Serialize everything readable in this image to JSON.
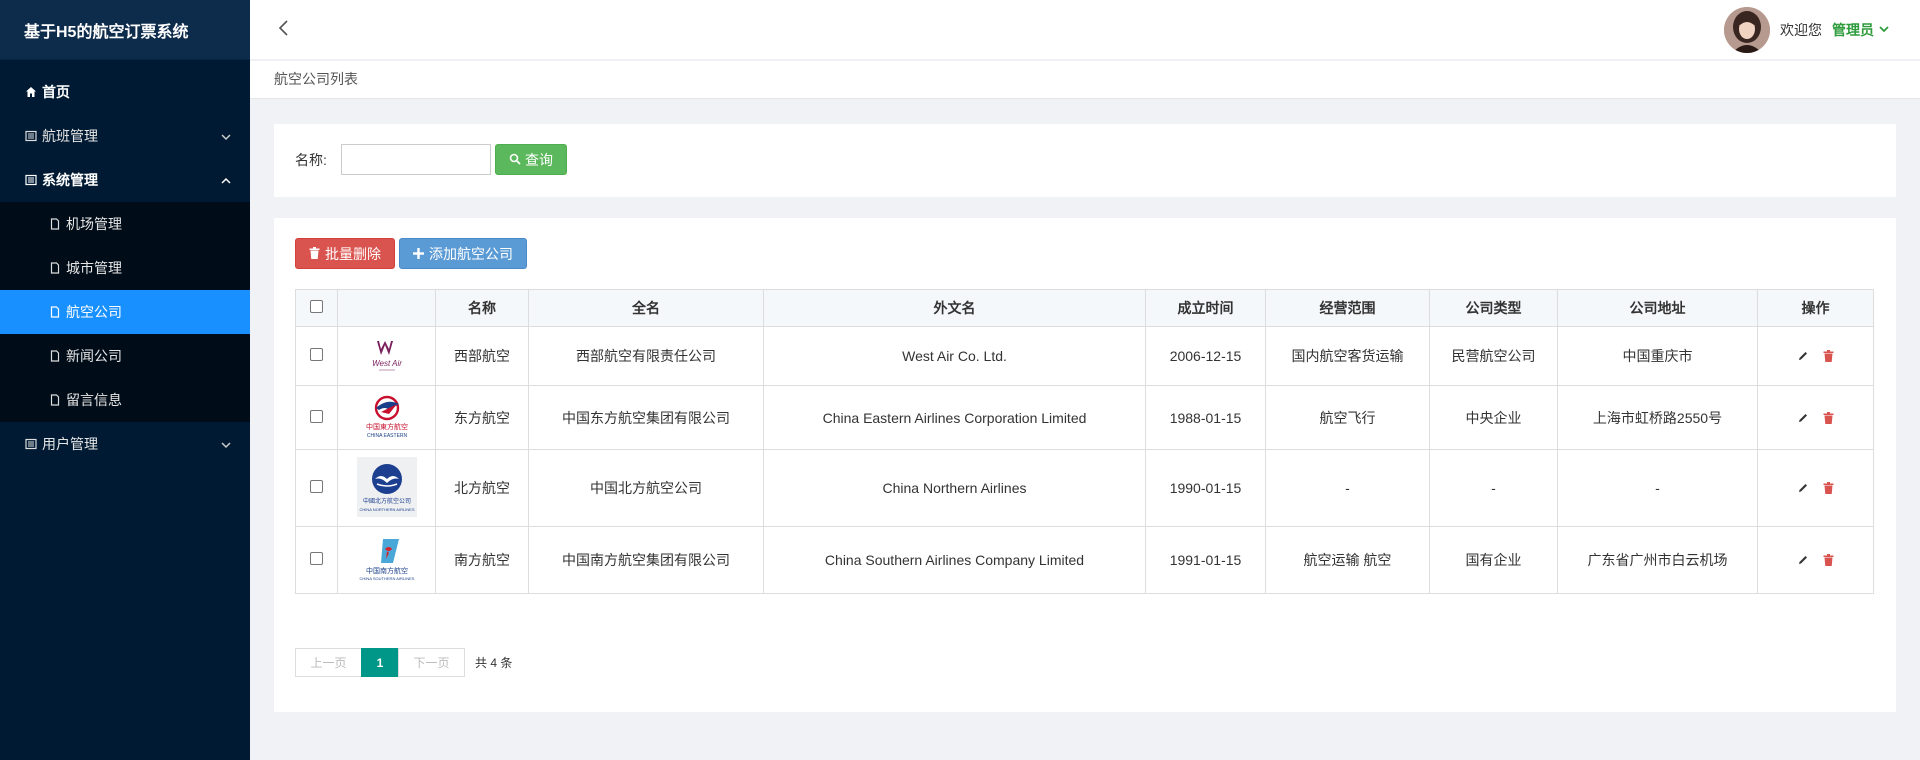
{
  "app": {
    "title": "基于H5的航空订票系统"
  },
  "sidebar": {
    "items": [
      {
        "label": "首页",
        "icon": "home-icon"
      },
      {
        "label": "航班管理",
        "icon": "list-icon",
        "arrow": "chevron-down-icon"
      },
      {
        "label": "系统管理",
        "icon": "list-icon",
        "arrow": "chevron-up-icon"
      },
      {
        "label": "用户管理",
        "icon": "list-icon",
        "arrow": "chevron-down-icon"
      }
    ],
    "sub_items": [
      {
        "label": "机场管理",
        "icon": "file-icon"
      },
      {
        "label": "城市管理",
        "icon": "file-icon"
      },
      {
        "label": "航空公司",
        "icon": "file-icon",
        "active": true
      },
      {
        "label": "新闻公司",
        "icon": "file-icon"
      },
      {
        "label": "留言信息",
        "icon": "file-icon"
      }
    ]
  },
  "header": {
    "welcome": "欢迎您",
    "user": "管理员"
  },
  "breadcrumb": {
    "label": "航空公司列表"
  },
  "search": {
    "label": "名称:",
    "value": "",
    "placeholder": "",
    "button": "查询"
  },
  "toolbar": {
    "batch_delete": "批量删除",
    "add": "添加航空公司"
  },
  "table": {
    "headers": [
      "",
      "",
      "名称",
      "全名",
      "外文名",
      "成立时间",
      "经营范围",
      "公司类型",
      "公司地址",
      "操作"
    ],
    "rows": [
      {
        "logo": "west-air-logo",
        "logo_text": "West Air",
        "name": "西部航空",
        "full_name": "西部航空有限责任公司",
        "foreign_name": "West Air Co. Ltd.",
        "founded": "2006-12-15",
        "scope": "国内航空客货运输",
        "type": "民营航空公司",
        "address": "中国重庆市"
      },
      {
        "logo": "china-eastern-logo",
        "logo_text": "中国東方航空",
        "logo_subtext": "CHINA EASTERN",
        "name": "东方航空",
        "full_name": "中国东方航空集团有限公司",
        "foreign_name": "China Eastern Airlines Corporation Limited",
        "founded": "1988-01-15",
        "scope": "航空飞行",
        "type": "中央企业",
        "address": "上海市虹桥路2550号"
      },
      {
        "logo": "china-northern-logo",
        "logo_text": "中國北方航空公司",
        "logo_subtext": "CHINA NORTHERN AIRLINES",
        "name": "北方航空",
        "full_name": "中国北方航空公司",
        "foreign_name": "China Northern Airlines",
        "founded": "1990-01-15",
        "scope": "-",
        "type": "-",
        "address": "-"
      },
      {
        "logo": "china-southern-logo",
        "logo_text": "中国南方航空",
        "logo_subtext": "CHINA SOUTHERN AIRLINES",
        "name": "南方航空",
        "full_name": "中国南方航空集团有限公司",
        "foreign_name": "China Southern Airlines Company Limited",
        "founded": "1991-01-15",
        "scope": "航空运输 航空",
        "type": "国有企业",
        "address": "广东省广州市白云机场"
      }
    ]
  },
  "pagination": {
    "prev": "上一页",
    "current": "1",
    "next": "下一页",
    "total": "共 4 条"
  },
  "colors": {
    "sidebar_bg": "#001a33",
    "active": "#1890ff",
    "search_btn": "#5cb85c",
    "delete_btn": "#d9534f",
    "add_btn": "#5b9bd5",
    "page_active": "#009688",
    "admin": "#2e9b3c"
  }
}
